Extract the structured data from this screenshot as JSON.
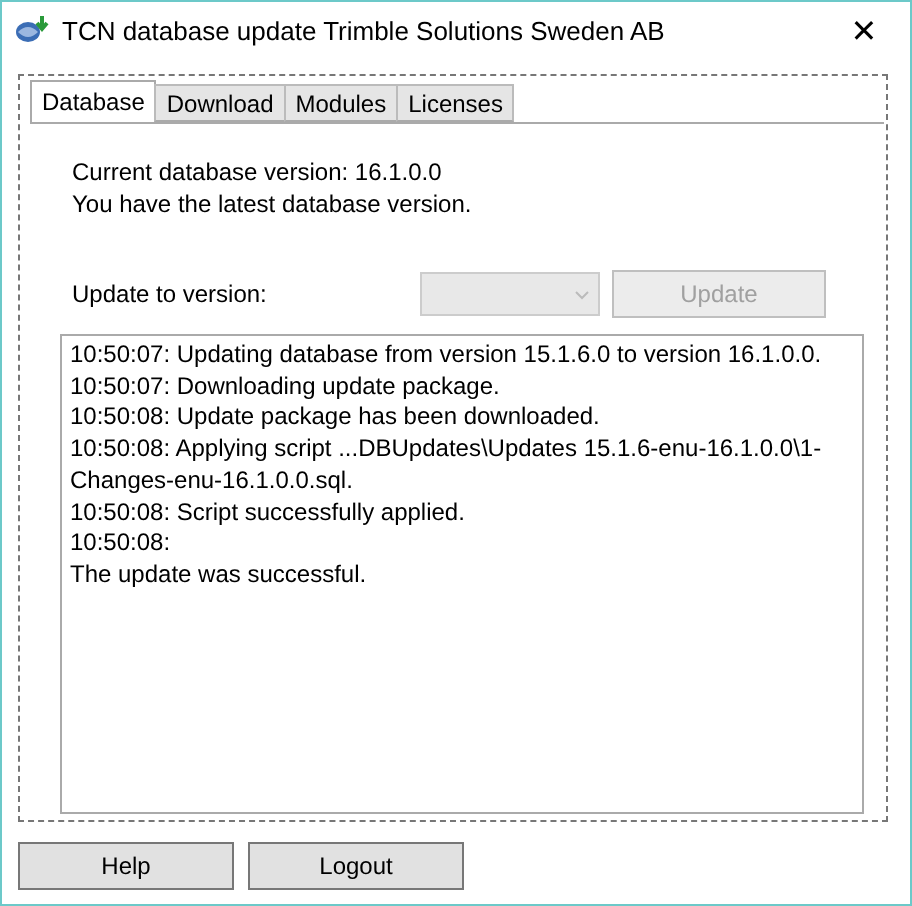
{
  "window": {
    "title": "TCN database update Trimble Solutions Sweden AB",
    "close": "✕"
  },
  "tabs": [
    {
      "label": "Database",
      "selected": true
    },
    {
      "label": "Download",
      "selected": false
    },
    {
      "label": "Modules",
      "selected": false
    },
    {
      "label": "Licenses",
      "selected": false
    }
  ],
  "status": [
    "Current database version: 16.1.0.0",
    "You have the latest database version."
  ],
  "update": {
    "label": "Update to version:",
    "disabled": true,
    "button": "Update"
  },
  "log": [
    "10:50:07: Updating database from version 15.1.6.0 to version 16.1.0.0.",
    "10:50:07: Downloading update package.",
    "10:50:08: Update package has been downloaded.",
    "10:50:08: Applying script ...DBUpdates\\Updates 15.1.6-enu-16.1.0.0\\1-Changes-enu-16.1.0.0.sql.",
    "10:50:08: Script successfully applied.",
    "10:50:08:",
    "The update was successful."
  ],
  "buttons": [
    "Help",
    "Logout"
  ]
}
